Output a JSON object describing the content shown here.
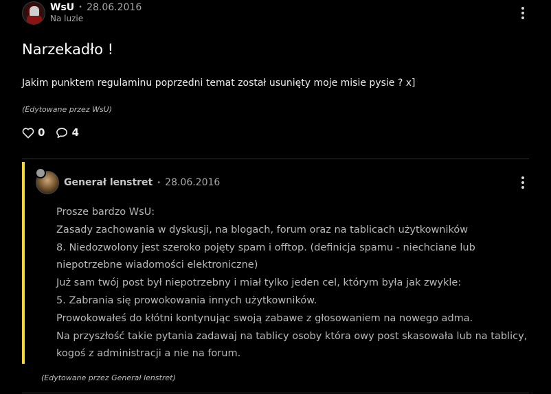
{
  "post": {
    "username": "WsU",
    "separator": "•",
    "date": "28.06.2016",
    "rank": "Na luzie",
    "title": "Narzekadło !",
    "body": "Jakim punktem regulaminu poprzedni temat został usunięty moje misie pysie ? x]",
    "edited": "(Edytowane przez WsU)",
    "likes": "0",
    "comments": "4"
  },
  "reply": {
    "username": "Generał lenstret",
    "separator": "•",
    "date": "28.06.2016",
    "lines": [
      "Prosze bardzo WsU:",
      "Zasady zachowania w dyskusji, na blogach, forum oraz na tablicach użytkowników",
      "8. Niedozwolony jest szeroko pojęty spam i offtop. (definicja spamu - niechciane lub",
      "niepotrzebne wiadomości elektroniczne)",
      "Już sam twój post był niepotrzebny i miał tylko jeden cel, którym była jak zwykle:",
      "5. Zabrania się prowokowania innych użytkowników.",
      "Prowokowałeś do kłótni kontynując swoją zabawe z głosowaniem na nowego adma.",
      "Na przyszłość takie pytania zadawaj na tablicy osoby która owy post skasowała lub na tablicy,",
      "kogoś z administracji a nie na forum."
    ],
    "edited": "(Edytowane przez Generał lenstret)"
  },
  "icons": {
    "post_menu": "more-vertical-icon",
    "reply_menu": "more-vertical-icon",
    "like": "heart-icon",
    "comment": "speech-bubble-icon"
  },
  "colors": {
    "background": "#000000",
    "reply_accent": "#f7d33b",
    "divider": "#333333"
  }
}
